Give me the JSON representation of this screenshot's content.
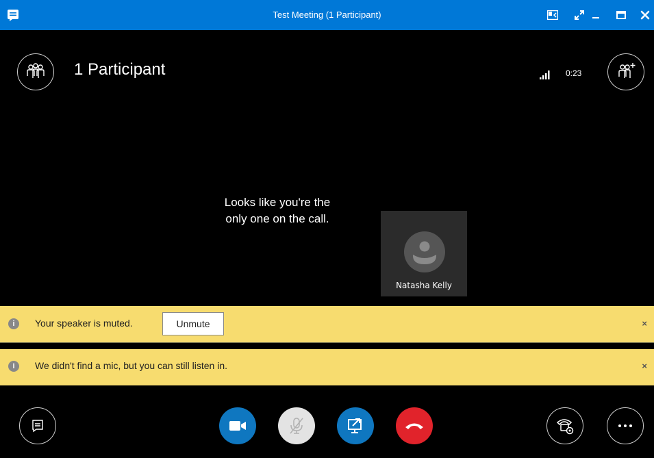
{
  "window": {
    "title": "Test Meeting (1 Participant)"
  },
  "header": {
    "participants_label": "1 Participant",
    "call_timer": "0:23"
  },
  "stage": {
    "alone_message_line1": "Looks like you're the",
    "alone_message_line2": "only one on the call.",
    "tile_name": "Natasha Kelly"
  },
  "banners": [
    {
      "message": "Your speaker is muted.",
      "action_label": "Unmute",
      "close": "×"
    },
    {
      "message": "We didn't find a mic, but you can still listen in.",
      "close": "×"
    }
  ],
  "icons": {
    "app": "chat-icon",
    "compact": "compact-view-icon",
    "fullscreen": "fullscreen-icon",
    "minimize": "minimize-icon",
    "maximize": "maximize-icon",
    "close": "close-icon",
    "participants": "participants-icon",
    "add_participant": "add-participant-icon",
    "signal": "signal-icon",
    "chat": "chat-icon",
    "video": "video-camera-icon",
    "mic": "mic-muted-icon",
    "share": "share-screen-icon",
    "hangup": "hang-up-icon",
    "call_controls": "call-controls-icon",
    "more": "more-options-icon"
  },
  "colors": {
    "title_bar": "#0078d7",
    "banner": "#f7dc6f",
    "accent_blue": "#0f77c0",
    "hangup_red": "#e1232b",
    "mic_disabled": "#e3e3e3"
  }
}
